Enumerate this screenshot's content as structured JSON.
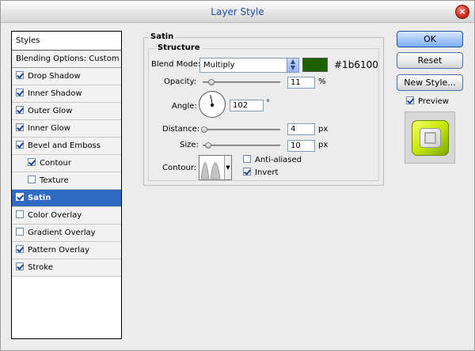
{
  "window": {
    "title": "Layer Style"
  },
  "styles_list": {
    "header": "Styles",
    "blending": "Blending Options: Custom",
    "items": [
      {
        "label": "Drop Shadow",
        "checked": true,
        "sub": false,
        "selected": false
      },
      {
        "label": "Inner Shadow",
        "checked": true,
        "sub": false,
        "selected": false
      },
      {
        "label": "Outer Glow",
        "checked": true,
        "sub": false,
        "selected": false
      },
      {
        "label": "Inner Glow",
        "checked": true,
        "sub": false,
        "selected": false
      },
      {
        "label": "Bevel and Emboss",
        "checked": true,
        "sub": false,
        "selected": false
      },
      {
        "label": "Contour",
        "checked": true,
        "sub": true,
        "selected": false
      },
      {
        "label": "Texture",
        "checked": false,
        "sub": true,
        "selected": false
      },
      {
        "label": "Satin",
        "checked": true,
        "sub": false,
        "selected": true
      },
      {
        "label": "Color Overlay",
        "checked": false,
        "sub": false,
        "selected": false
      },
      {
        "label": "Gradient Overlay",
        "checked": false,
        "sub": false,
        "selected": false
      },
      {
        "label": "Pattern Overlay",
        "checked": true,
        "sub": false,
        "selected": false
      },
      {
        "label": "Stroke",
        "checked": true,
        "sub": false,
        "selected": false
      }
    ]
  },
  "satin": {
    "group_title": "Satin",
    "structure_title": "Structure",
    "blend_mode_label": "Blend Mode:",
    "blend_mode_value": "Multiply",
    "color": "#1b6100",
    "color_hex_label": "#1b6100",
    "opacity_label": "Opacity:",
    "opacity_value": "11",
    "opacity_unit": "%",
    "opacity_fraction": 0.11,
    "angle_label": "Angle:",
    "angle_value": "102",
    "angle_unit": "°",
    "distance_label": "Distance:",
    "distance_value": "4",
    "distance_unit": "px",
    "size_label": "Size:",
    "size_value": "10",
    "size_unit": "px",
    "contour_label": "Contour:",
    "anti_aliased_label": "Anti-aliased",
    "anti_aliased_checked": false,
    "invert_label": "Invert",
    "invert_checked": true
  },
  "buttons": {
    "ok": "OK",
    "reset": "Reset",
    "new_style": "New Style...",
    "preview_label": "Preview",
    "preview_checked": true
  }
}
